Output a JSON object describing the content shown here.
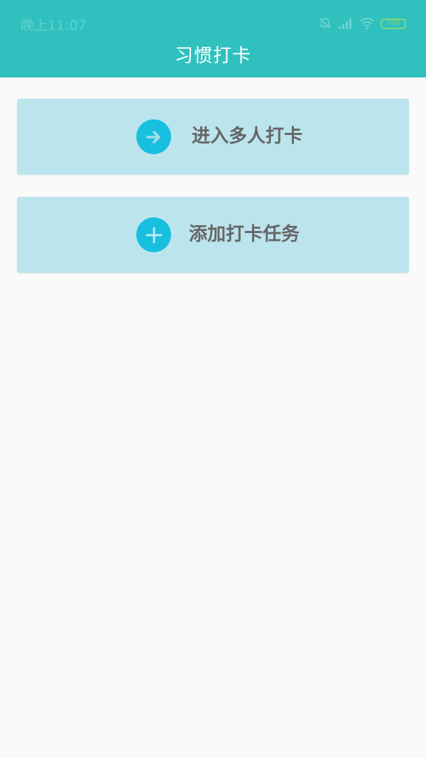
{
  "status_bar": {
    "time": "晚上11:07",
    "battery": "100",
    "icons": [
      "bell-muted-icon",
      "signal-icon",
      "wifi-icon",
      "battery-icon"
    ]
  },
  "header": {
    "title": "习惯打卡",
    "background": "#30c1bf"
  },
  "actions": [
    {
      "label": "进入多人打卡",
      "icon": "arrow-right-icon"
    },
    {
      "label": "添加打卡任务",
      "icon": "plus-icon"
    }
  ],
  "colors": {
    "card_background": "#bce4ed",
    "icon_circle": "#18bfdf",
    "label_text": "#666666",
    "page_background": "#fafafa"
  }
}
